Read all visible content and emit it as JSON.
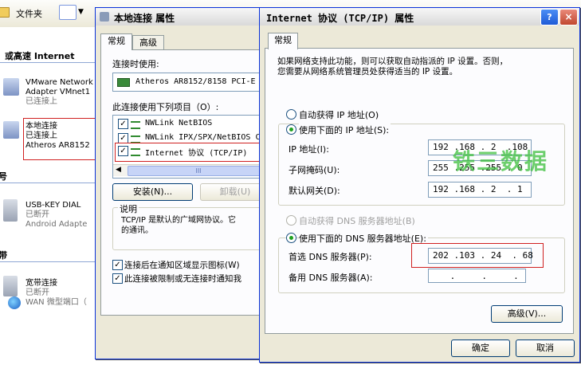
{
  "explorer": {
    "toolbar_folder_label": "文件夹",
    "group_lan": "或高速 Internet",
    "group_dialup": "号",
    "group_broadband": "带",
    "items": [
      {
        "line1": "VMware Network",
        "line2": "Adapter VMnet1",
        "line3": "已连接上"
      },
      {
        "line1": "本地连接",
        "line2": "已连接上",
        "line3": "Atheros AR8152"
      },
      {
        "line1": "USB-KEY DIAL",
        "line2": "已断开",
        "line3": "Android Adapte"
      },
      {
        "line1": "宽带连接",
        "line2": "已断开",
        "line3": "WAN 微型端口（"
      }
    ]
  },
  "local_dialog": {
    "title": "本地连接 属性",
    "tabs": [
      "常规",
      "高级"
    ],
    "connect_using_label": "连接时使用:",
    "adapter_name": "Atheros AR8152/8158 PCI-E",
    "items_label": "此连接使用下列项目（O）:",
    "components": [
      {
        "label": "NWLink NetBIOS",
        "checked": "✓"
      },
      {
        "label": "NWLink IPX/SPX/NetBIOS C",
        "checked": "✓"
      },
      {
        "label": "Internet 协议 (TCP/IP)",
        "checked": "✓"
      }
    ],
    "scroll_thumb": "III",
    "install_button": "安装(N)...",
    "uninstall_button": "卸载(U)",
    "description_label": "说明",
    "description_text": "TCP/IP 是默认的广域网协议。它\n的通讯。",
    "show_icon_label": "连接后在通知区域显示图标(W)",
    "notify_label": "此连接被限制或无连接时通知我",
    "check": "✓"
  },
  "tcp_dialog": {
    "title": "Internet 协议 (TCP/IP) 属性",
    "help_button": "?",
    "close_button": "×",
    "tab": "常规",
    "intro": "如果网络支持此功能，则可以获取自动指派的 IP 设置。否则，\n您需要从网络系统管理员处获得适当的 IP 设置。",
    "auto_ip_label": "自动获得 IP 地址(O)",
    "manual_ip_label": "使用下面的 IP 地址(S):",
    "ip_label": "IP 地址(I):",
    "ip_value": "192 .168 . 2  .108",
    "mask_label": "子网掩码(U):",
    "mask_value": "255 .255 .255 . 0",
    "gateway_label": "默认网关(D):",
    "gateway_value": "192 .168 . 2  . 1",
    "auto_dns_label": "自动获得 DNS 服务器地址(B)",
    "manual_dns_label": "使用下面的 DNS 服务器地址(E):",
    "preferred_dns_label": "首选 DNS 服务器(P):",
    "preferred_dns_value": "202 .103 . 24  . 68",
    "alternate_dns_label": "备用 DNS 服务器(A):",
    "alternate_dns_value": " .     .     .",
    "advanced_button": "高级(V)...",
    "ok_button": "确定",
    "cancel_button": "取消"
  },
  "watermark": "铁三数据",
  "colors": {
    "highlight": "#d02020",
    "watermark": "#3dbf3d",
    "dialog_bg": "#ece9d8"
  }
}
